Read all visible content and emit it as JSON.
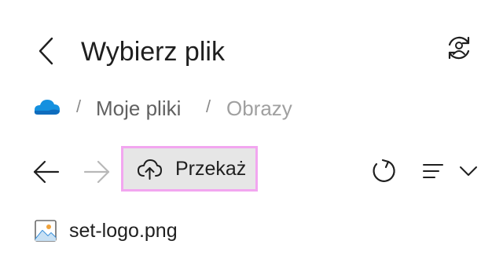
{
  "header": {
    "title": "Wybierz plik",
    "back_icon": "chevron-left-icon",
    "switch_icon": "person-switch-icon"
  },
  "breadcrumb": {
    "root_icon": "onedrive-cloud-icon",
    "separator": "/",
    "items": [
      {
        "label": "Moje pliki",
        "current": false
      },
      {
        "label": "Obrazy",
        "current": true
      }
    ]
  },
  "toolbar": {
    "back_icon": "arrow-left-icon",
    "forward_icon": "arrow-right-icon",
    "upload_label": "Przekaż",
    "upload_icon": "cloud-upload-icon",
    "refresh_icon": "refresh-icon",
    "sort_icon": "list-lines-icon"
  },
  "files": [
    {
      "name": "set-logo.png",
      "icon": "image-file-icon"
    }
  ],
  "colors": {
    "upload_bg": "#e6e6e6",
    "upload_border": "#f2a6f0",
    "onedrive_blue": "#0f6cbd",
    "disabled": "#a0a0a0"
  }
}
